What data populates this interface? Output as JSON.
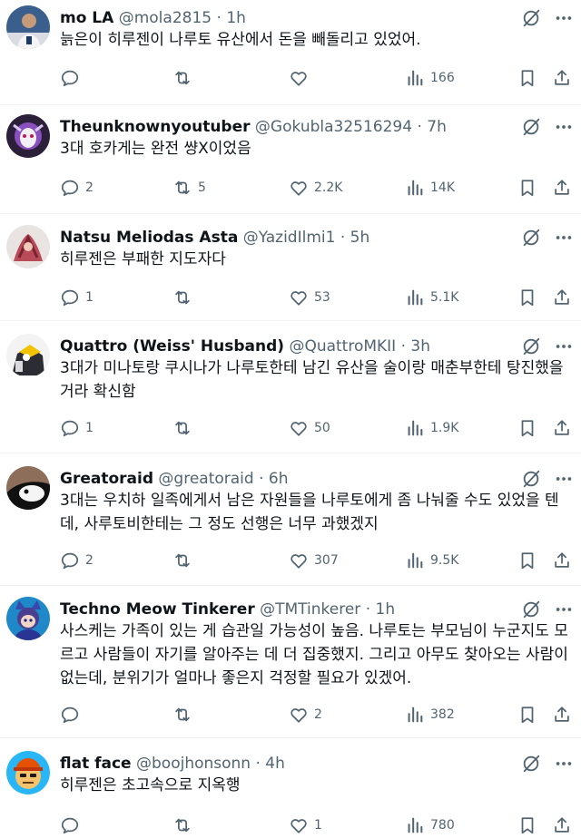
{
  "colors": {
    "text": "#0f1419",
    "secondary": "#536471",
    "divider": "#eff3f4",
    "background": "#ffffff"
  },
  "tweets": [
    {
      "name": "mo LA",
      "handle": "@mola2815",
      "sep": " · ",
      "time": "1h",
      "text": "늙은이 히루젠이 나루토 유산에서 돈을 빼돌리고 있었어.",
      "replies": "",
      "retweets": "",
      "likes": "",
      "views": "166"
    },
    {
      "name": "Theunknownyoutuber",
      "handle": "@Gokubla32516294",
      "sep": " · ",
      "time": "7h",
      "text": "3대 호카게는 완전 썅X이었음",
      "replies": "2",
      "retweets": "5",
      "likes": "2.2K",
      "views": "14K"
    },
    {
      "name": "Natsu Meliodas Asta",
      "handle": "@YazidIlmi1",
      "sep": " · ",
      "time": "5h",
      "text": "히루젠은 부패한 지도자다",
      "replies": "1",
      "retweets": "",
      "likes": "53",
      "views": "5.1K"
    },
    {
      "name": "Quattro (Weiss' Husband)",
      "handle": "@QuattroMKII",
      "sep": " · ",
      "time": "3h",
      "text": "3대가 미나토랑 쿠시나가 나루토한테 남긴 유산을 술이랑 매춘부한테 탕진했을 거라 확신함",
      "replies": "1",
      "retweets": "",
      "likes": "50",
      "views": "1.9K"
    },
    {
      "name": "Greatoraid",
      "handle": "@greatoraid",
      "sep": " · ",
      "time": "6h",
      "text": "3대는 우치하 일족에게서 남은 자원들을 나루토에게 좀 나눠줄 수도 있었을 텐데, 사루토비한테는 그 정도 선행은 너무 과했겠지",
      "replies": "2",
      "retweets": "",
      "likes": "307",
      "views": "9.5K"
    },
    {
      "name": "Techno Meow Tinkerer",
      "handle": "@TMTinkerer",
      "sep": " · ",
      "time": "1h",
      "text": "사스케는 가족이 있는 게 습관일 가능성이 높음. 나루토는 부모님이 누군지도 모르고 사람들이 자기를 알아주는 데 더 집중했지. 그리고 아무도 찾아오는 사람이 없는데, 분위기가 얼마나 좋은지 걱정할 필요가 있겠어.",
      "replies": "",
      "retweets": "",
      "likes": "2",
      "views": "382"
    },
    {
      "name": "flat face",
      "handle": "@boojhonsonn",
      "sep": " · ",
      "time": "4h",
      "text": "히루젠은 초고속으로 지옥행",
      "replies": "",
      "retweets": "",
      "likes": "1",
      "views": "780"
    }
  ],
  "icons": {
    "grok": "grok-icon",
    "more": "more-icon",
    "reply": "reply-icon",
    "retweet": "retweet-icon",
    "like": "like-icon",
    "views": "views-icon",
    "bookmark": "bookmark-icon",
    "share": "share-icon"
  }
}
